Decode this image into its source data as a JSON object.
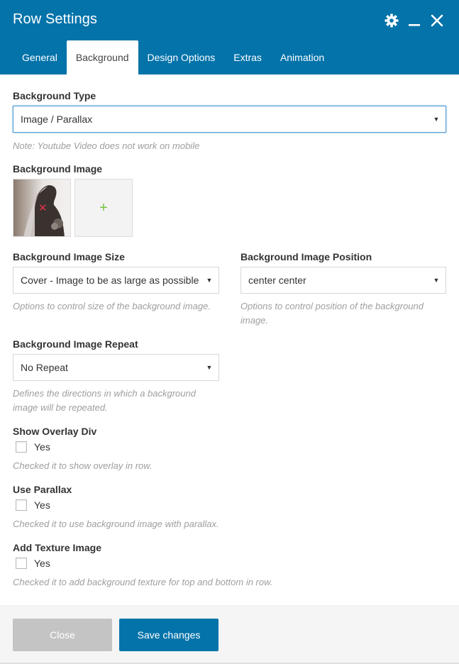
{
  "header": {
    "title": "Row Settings",
    "controls": [
      "gear-icon",
      "minimize-icon",
      "close-icon"
    ],
    "background_color": "#0473aa"
  },
  "tabs": [
    {
      "label": "General",
      "active": false
    },
    {
      "label": "Background",
      "active": true
    },
    {
      "label": "Design Options",
      "active": false
    },
    {
      "label": "Extras",
      "active": false
    },
    {
      "label": "Animation",
      "active": false
    }
  ],
  "fields": {
    "background_type": {
      "label": "Background Type",
      "value": "Image / Parallax",
      "note": "Note: Youtube Video does not work on mobile"
    },
    "background_image": {
      "label": "Background Image",
      "remove_glyph": "✕",
      "add_glyph": "+"
    },
    "image_size": {
      "label": "Background Image Size",
      "value": "Cover - Image to be as large as possible",
      "note": "Options to control size of the background image."
    },
    "image_position": {
      "label": "Background Image Position",
      "value": "center center",
      "note": "Options to control position of the background image."
    },
    "image_repeat": {
      "label": "Background Image Repeat",
      "value": "No Repeat",
      "note": "Defines the directions in which a background image will be repeated."
    },
    "overlay": {
      "label": "Show Overlay Div",
      "checkbox_label": "Yes",
      "checked": false,
      "note": "Checked it to show overlay in row."
    },
    "parallax": {
      "label": "Use Parallax",
      "checkbox_label": "Yes",
      "checked": false,
      "note": "Checked it to use background image with parallax."
    },
    "texture": {
      "label": "Add Texture Image",
      "checkbox_label": "Yes",
      "checked": false,
      "note": "Checked it to add background texture for top and bottom in row."
    }
  },
  "footer": {
    "close_label": "Close",
    "save_label": "Save changes"
  },
  "colors": {
    "accent": "#0473aa",
    "add_icon": "#7ac142",
    "remove_icon": "#e0324b",
    "close_button": "#c4c4c4"
  }
}
